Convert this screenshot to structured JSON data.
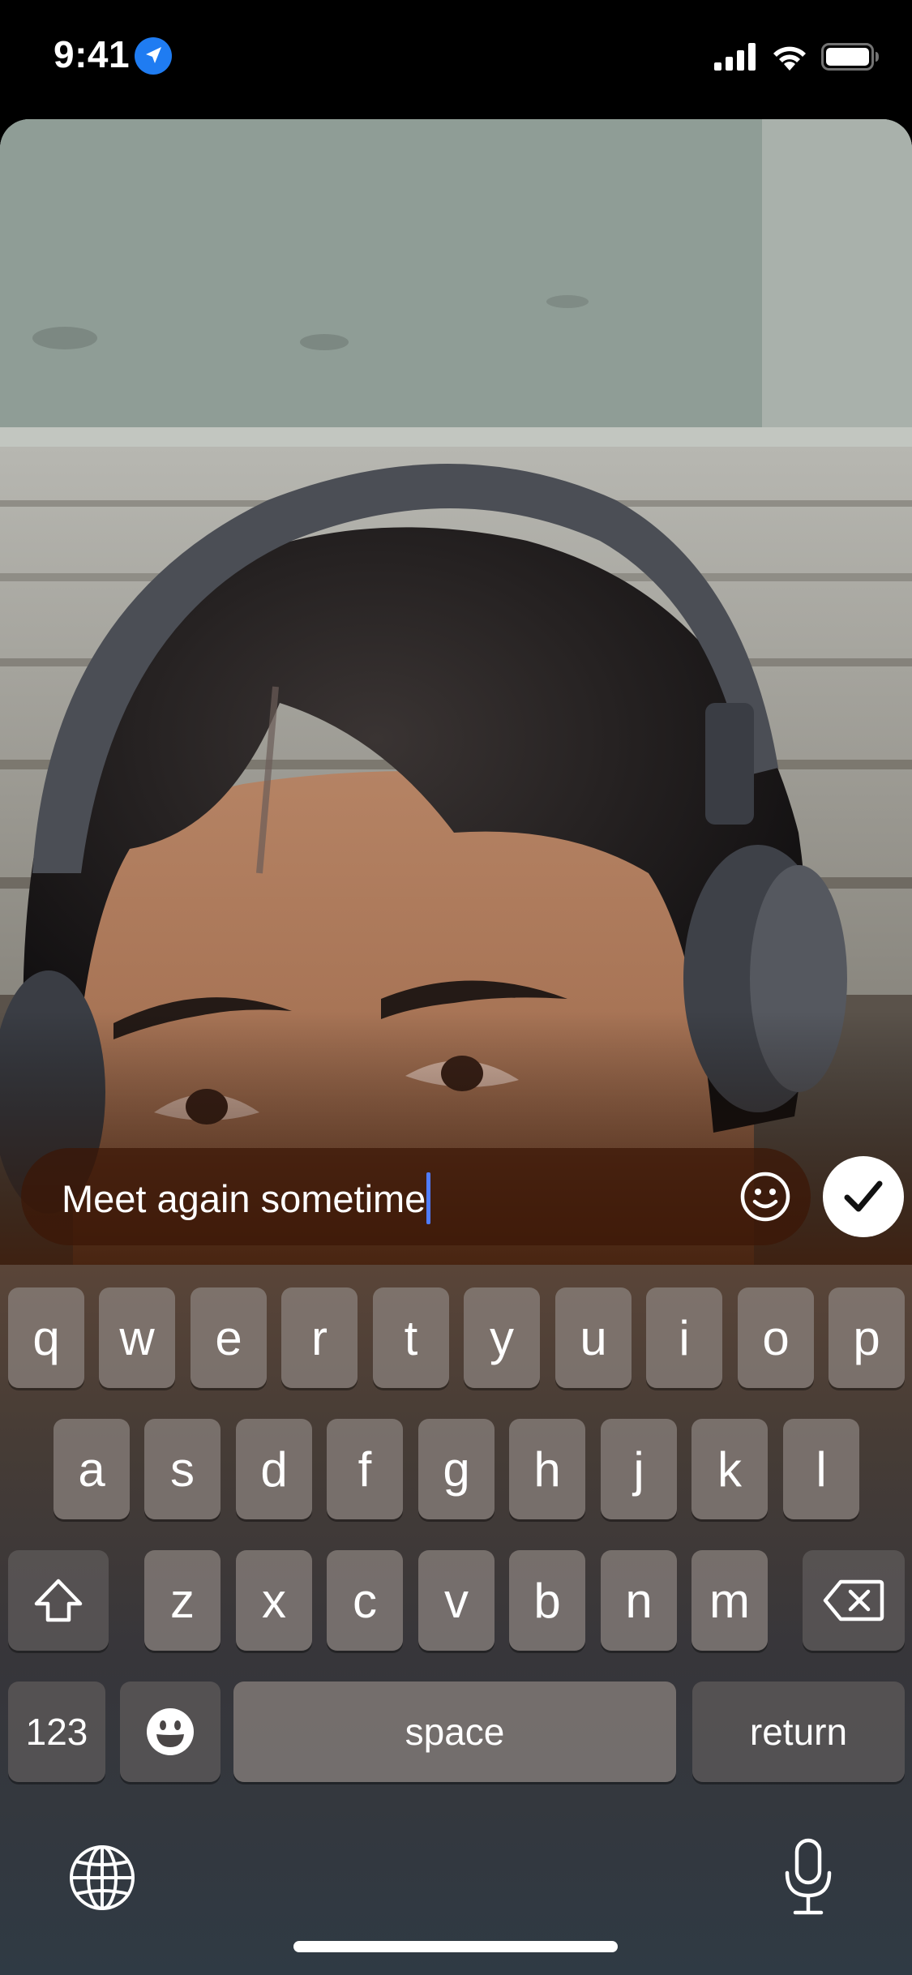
{
  "status_bar": {
    "time": "9:41",
    "location_icon": "location-arrow-icon",
    "signal_icon": "cellular-signal-icon",
    "wifi_icon": "wifi-icon",
    "battery_icon": "battery-icon"
  },
  "photo": {
    "icon": "photo-preview"
  },
  "caption": {
    "value": "Meet again sometime",
    "emoji_icon": "smiley-face-icon",
    "confirm_icon": "checkmark-icon"
  },
  "keyboard": {
    "row1": [
      "q",
      "w",
      "e",
      "r",
      "t",
      "y",
      "u",
      "i",
      "o",
      "p"
    ],
    "row2": [
      "a",
      "s",
      "d",
      "f",
      "g",
      "h",
      "j",
      "k",
      "l"
    ],
    "row3": [
      "z",
      "x",
      "c",
      "v",
      "b",
      "n",
      "m"
    ],
    "shift_icon": "shift-arrow-icon",
    "delete_icon": "delete-backspace-icon",
    "numbers_label": "123",
    "emoji_key_icon": "emoji-keyboard-icon",
    "space_label": "space",
    "return_label": "return",
    "globe_icon": "globe-icon",
    "mic_icon": "microphone-icon"
  },
  "colors": {
    "caret": "#4f7cff",
    "location_badge": "#1f7cf2"
  }
}
